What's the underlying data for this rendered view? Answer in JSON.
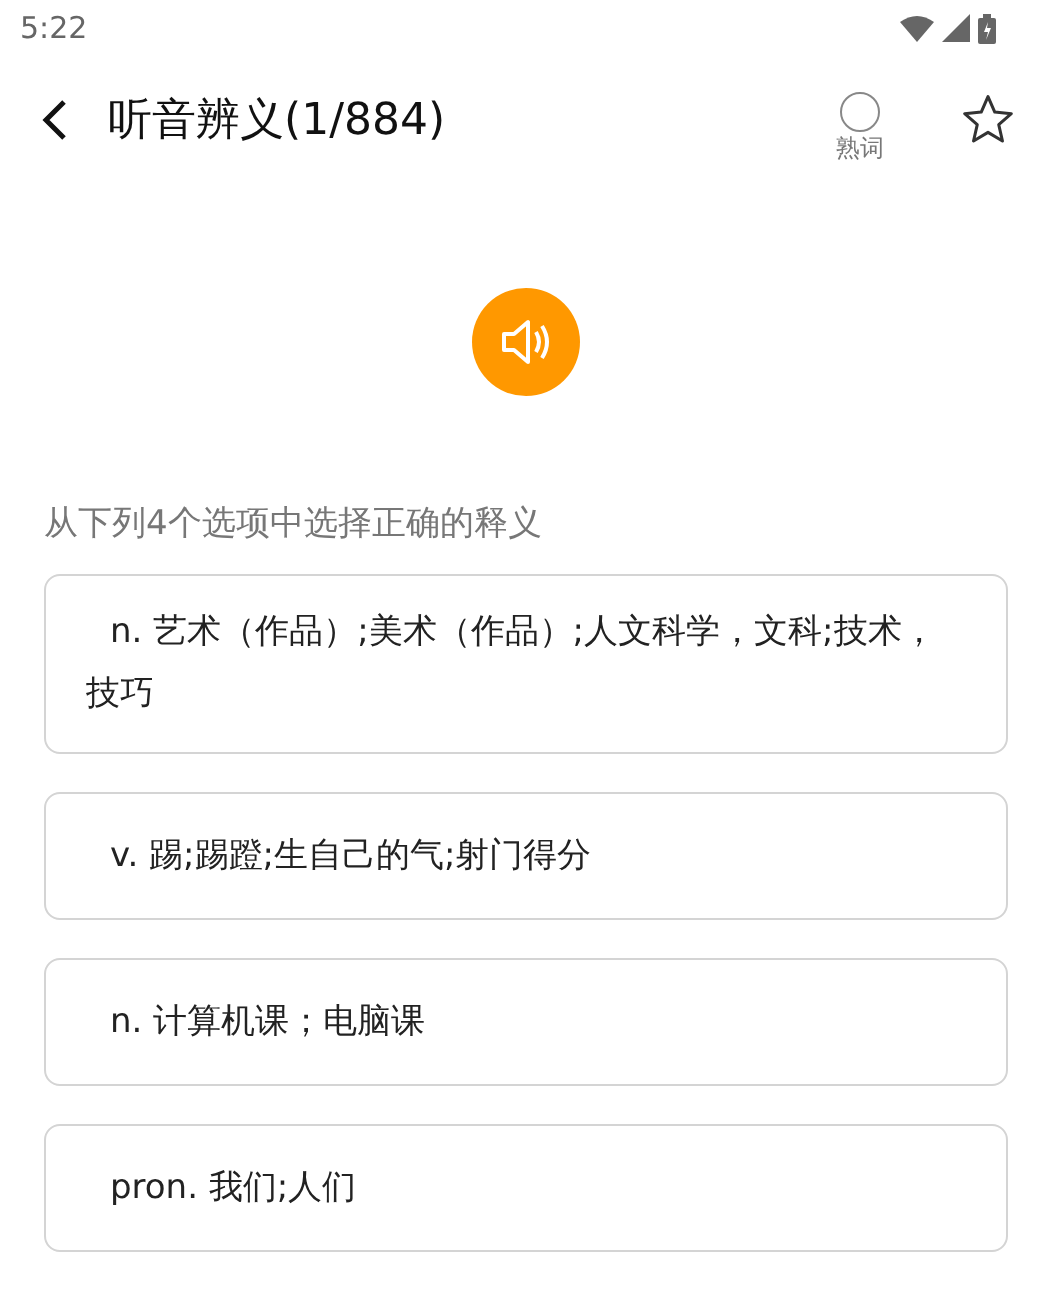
{
  "status_bar": {
    "time": "5:22"
  },
  "header": {
    "title": "听音辨义(1/884)",
    "known_word": {
      "label": "熟词",
      "checked": false
    },
    "favorite": {
      "starred": false
    }
  },
  "instruction": "从下列4个选项中选择正确的释义",
  "options": [
    {
      "text": "n. 艺术（作品）;美术（作品）;人文科学，文科;技术，技巧"
    },
    {
      "text": "v. 踢;踢蹬;生自己的气;射门得分"
    },
    {
      "text": "n. 计算机课；电脑课"
    },
    {
      "text": "pron. 我们;人们"
    }
  ]
}
